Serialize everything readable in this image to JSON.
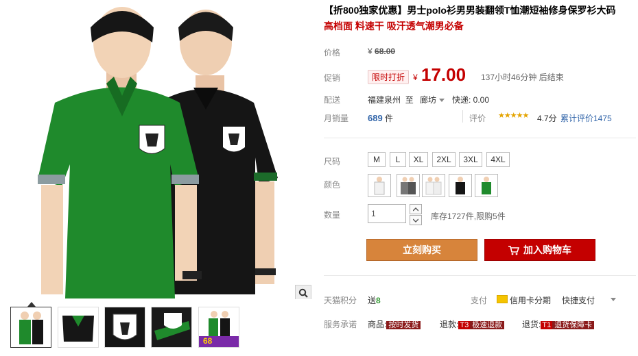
{
  "product": {
    "title": "【折800独家优惠】男士polo衫男男装翻领T恤潮短袖修身保罗衫大码",
    "subtitle": "高档面 料速干 吸汗透气潮男必备"
  },
  "price": {
    "label": "价格",
    "yen": "¥",
    "original": "68.00",
    "promo_label": "促销",
    "promo_tag": "限时打折",
    "promo_price": "17.00",
    "countdown": "137小时46分钟 后结束"
  },
  "delivery": {
    "label": "配送",
    "from": "福建泉州",
    "to_word": "至",
    "destination": "廊坊",
    "fee": "快递: 0.00"
  },
  "sales": {
    "label": "月销量",
    "count": "689",
    "unit": "件",
    "rating_label": "评价",
    "stars": "★★★★★",
    "rating_value": 4.7,
    "score": "4.7分",
    "reviews": "累计评价1475"
  },
  "size": {
    "label": "尺码",
    "options": [
      "M",
      "L",
      "XL",
      "2XL",
      "3XL",
      "4XL"
    ]
  },
  "color": {
    "label": "颜色",
    "swatches": [
      "white-shirt",
      "gray-shirts",
      "white-pair",
      "black-shirt",
      "green-shirt"
    ]
  },
  "quantity": {
    "label": "数量",
    "value": "1",
    "stock": "库存1727件,限购5件"
  },
  "buttons": {
    "buy_now": "立刻购买",
    "add_cart": "加入购物车"
  },
  "points": {
    "label": "天猫积分",
    "prefix": "送",
    "value": "8"
  },
  "payment": {
    "label": "支付",
    "credit": "信用卡分期",
    "quick": "快捷支付"
  },
  "service": {
    "label": "服务承诺",
    "item1_prefix": "商品:",
    "item1_tag": "按时发货",
    "item2_prefix": "退款:",
    "item2_t": "T3",
    "item2_tag": "极速退款",
    "item3_prefix": "退货:",
    "item3_t": "T1",
    "item3_tag": "退货保障卡"
  },
  "gallery": {
    "thumb_badge": "68"
  },
  "colors": {
    "accent_red": "#c40000",
    "buy_orange": "#d7843b",
    "shirt_green": "#1f8a2c",
    "link_blue": "#3366aa"
  }
}
